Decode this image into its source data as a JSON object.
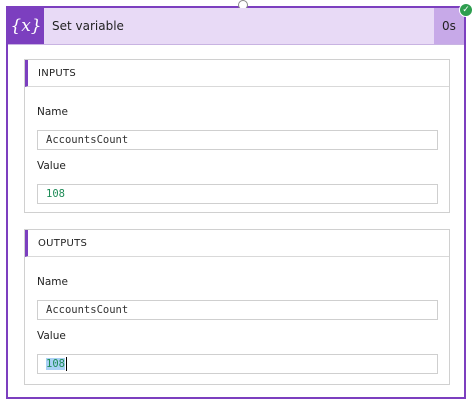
{
  "action": {
    "title": "Set variable",
    "duration": "0s",
    "icon_name": "variable-icon",
    "icon_text": "{x}",
    "status_icon": "success-check-icon",
    "accent_color": "#7c3fbf"
  },
  "inputs": {
    "heading": "INPUTS",
    "name_label": "Name",
    "name_value": "AccountsCount",
    "value_label": "Value",
    "value_value": "108"
  },
  "outputs": {
    "heading": "OUTPUTS",
    "name_label": "Name",
    "name_value": "AccountsCount",
    "value_label": "Value",
    "value_value": "108"
  }
}
